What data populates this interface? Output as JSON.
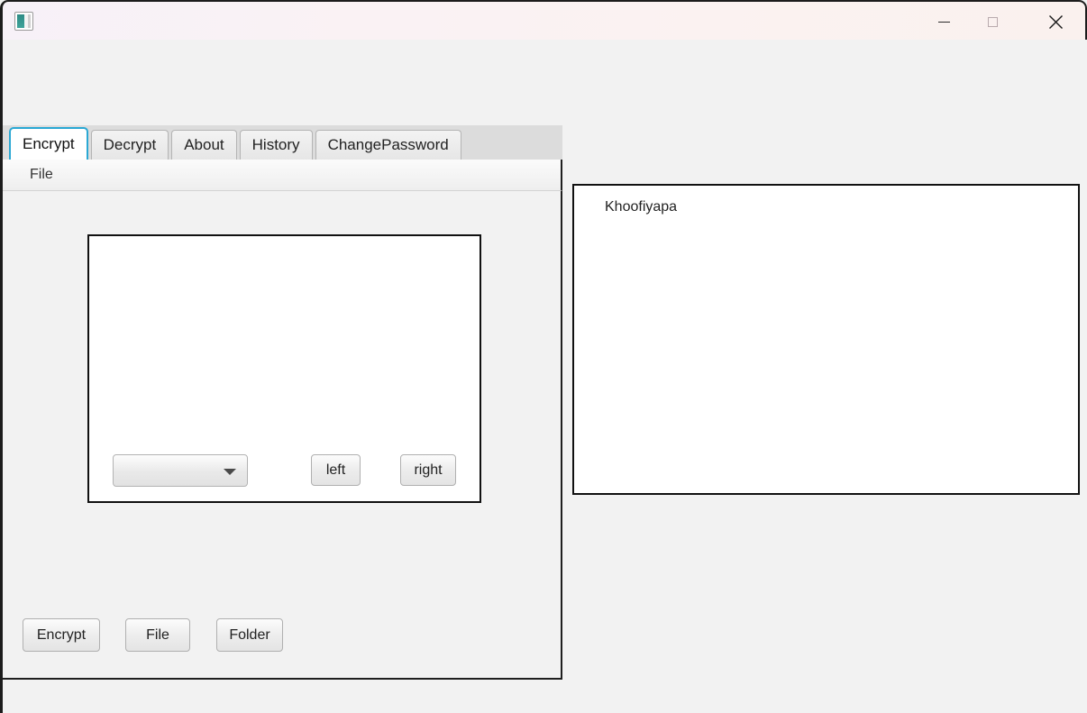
{
  "window": {
    "icon_name": "app-image-icon",
    "controls": {
      "minimize": "minimize-icon",
      "maximize": "maximize-icon",
      "close": "close-icon"
    }
  },
  "tabs": {
    "items": [
      {
        "label": "Encrypt",
        "selected": true
      },
      {
        "label": "Decrypt",
        "selected": false
      },
      {
        "label": "About",
        "selected": false
      },
      {
        "label": "History",
        "selected": false
      },
      {
        "label": "ChangePassword",
        "selected": false
      }
    ]
  },
  "menubar": {
    "items": [
      {
        "label": "File"
      }
    ]
  },
  "left_panel": {
    "inner_box": {
      "combo": {
        "value": "",
        "placeholder": "",
        "chevron_icon": "chevron-down-icon"
      },
      "buttons": [
        {
          "label": "left"
        },
        {
          "label": "right"
        }
      ]
    },
    "actions": [
      {
        "label": "Encrypt"
      },
      {
        "label": "File"
      },
      {
        "label": "Folder"
      }
    ]
  },
  "right_panel": {
    "text": "Khoofiyapa"
  },
  "colors": {
    "accent_tab": "#2aa8d4",
    "titlebar_start": "#f7f1f8",
    "titlebar_end": "#faf1ee",
    "panel_bg": "#f2f2f2",
    "border_dark": "#1f1f1f",
    "icon_teal": "#2e8b85"
  }
}
